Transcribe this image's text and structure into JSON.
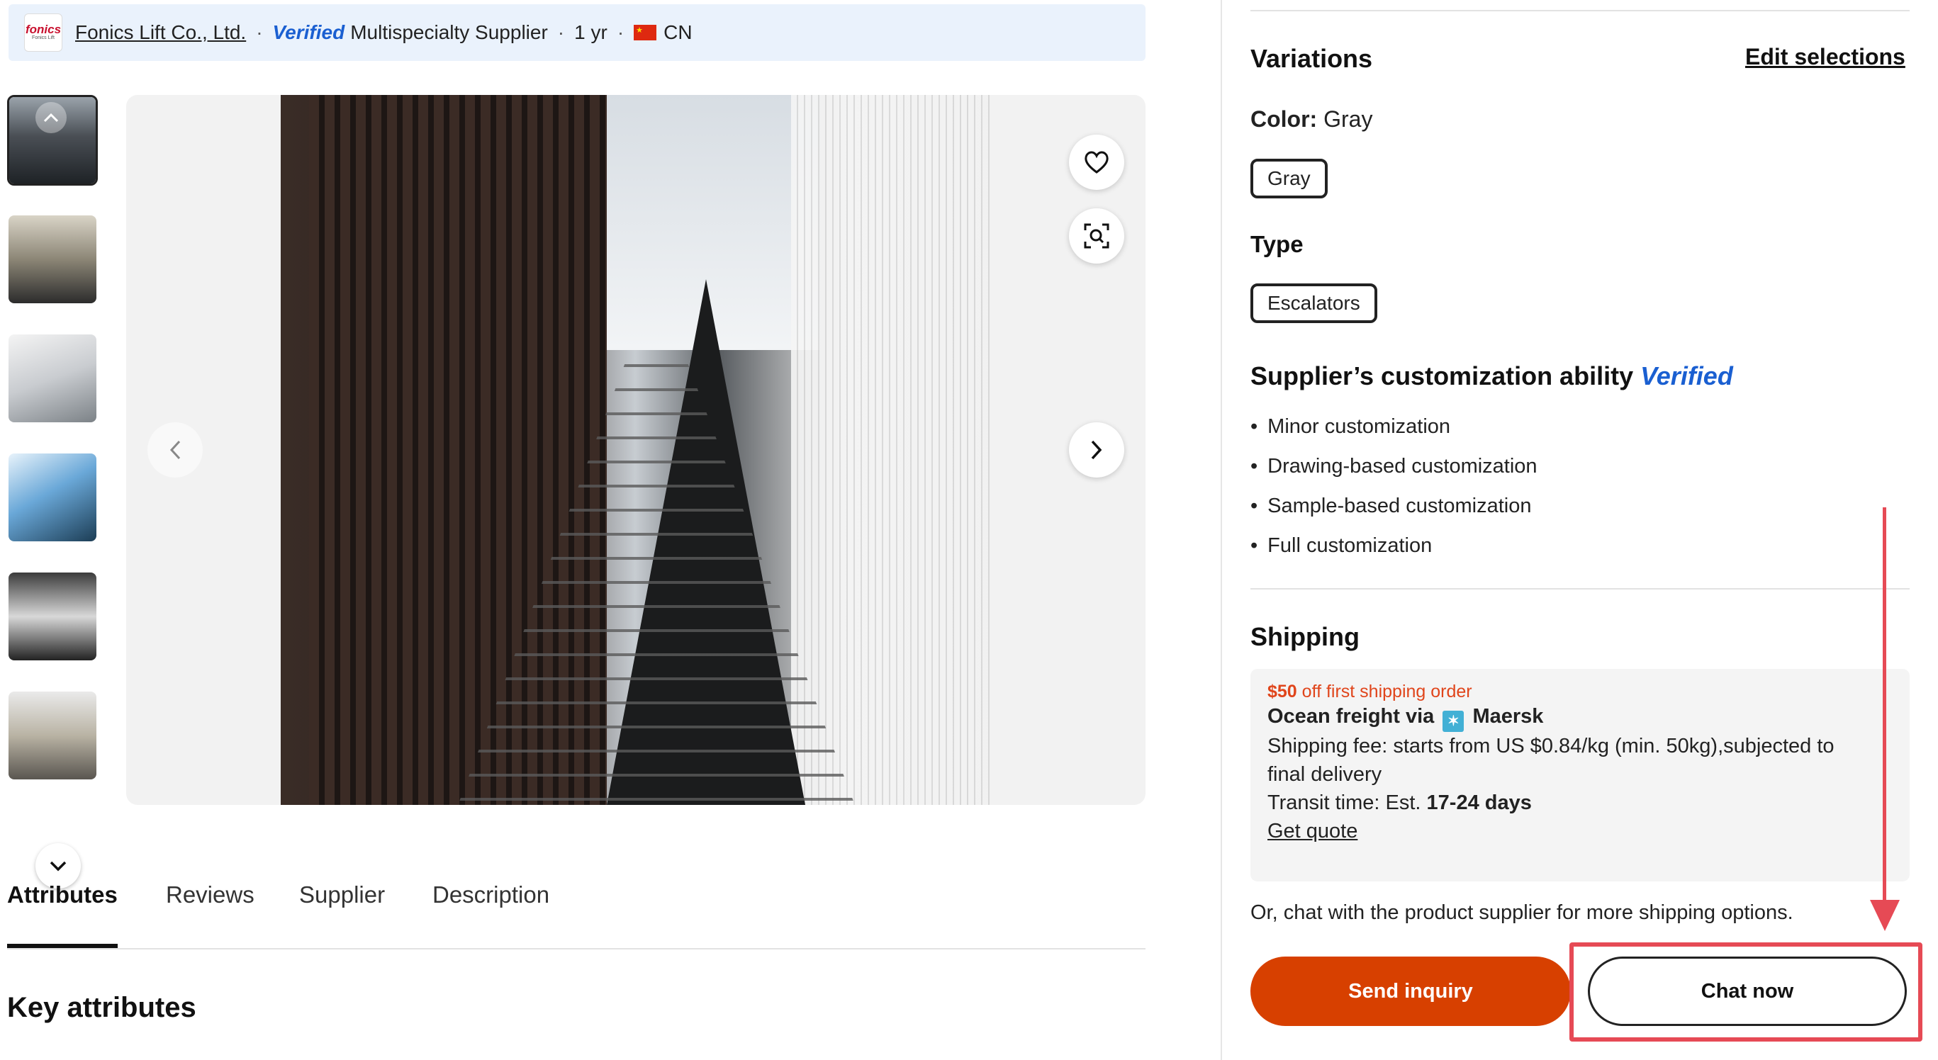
{
  "supplier_bar": {
    "logo_text": "fonics",
    "logo_sub": "Fonics Lift",
    "name": "Fonics Lift Co., Ltd.",
    "verified": "Verified",
    "type": "Multispecialty Supplier",
    "years": "1 yr",
    "country": "CN"
  },
  "gallery": {
    "thumbnails": [
      "escalator-1",
      "escalator-2",
      "escalator-3",
      "escalator-4",
      "escalator-5",
      "escalator-6"
    ]
  },
  "tabs": [
    {
      "label": "Attributes",
      "active": true
    },
    {
      "label": "Reviews"
    },
    {
      "label": "Supplier"
    },
    {
      "label": "Description"
    }
  ],
  "key_attributes_title": "Key attributes",
  "variations": {
    "title": "Variations",
    "edit_label": "Edit selections",
    "color_label": "Color:",
    "color_value": "Gray",
    "color_chip": "Gray",
    "type_label": "Type",
    "type_chip": "Escalators"
  },
  "customization": {
    "title": "Supplier’s customization ability",
    "verified": "Verified",
    "items": [
      "Minor customization",
      "Drawing-based customization",
      "Sample-based customization",
      "Full customization"
    ]
  },
  "shipping": {
    "title": "Shipping",
    "promo_amount": "$50",
    "promo_text": "off first shipping order",
    "method_prefix": "Ocean freight via",
    "carrier": "Maersk",
    "fee": "Shipping fee: starts from US $0.84/kg (min. 50kg),subjected to",
    "fee_cont": "final delivery",
    "transit_prefix": "Transit time: Est.",
    "transit_days": "17-24 days",
    "quote_link": "Get quote",
    "chat_note": "Or, chat with the product supplier for more shipping options."
  },
  "actions": {
    "inquiry": "Send inquiry",
    "chat": "Chat now"
  },
  "colors": {
    "accent": "#d74000",
    "verified_blue": "#1a5fd1",
    "promo_orange": "#e0451b",
    "annotation_red": "#e64a55"
  }
}
